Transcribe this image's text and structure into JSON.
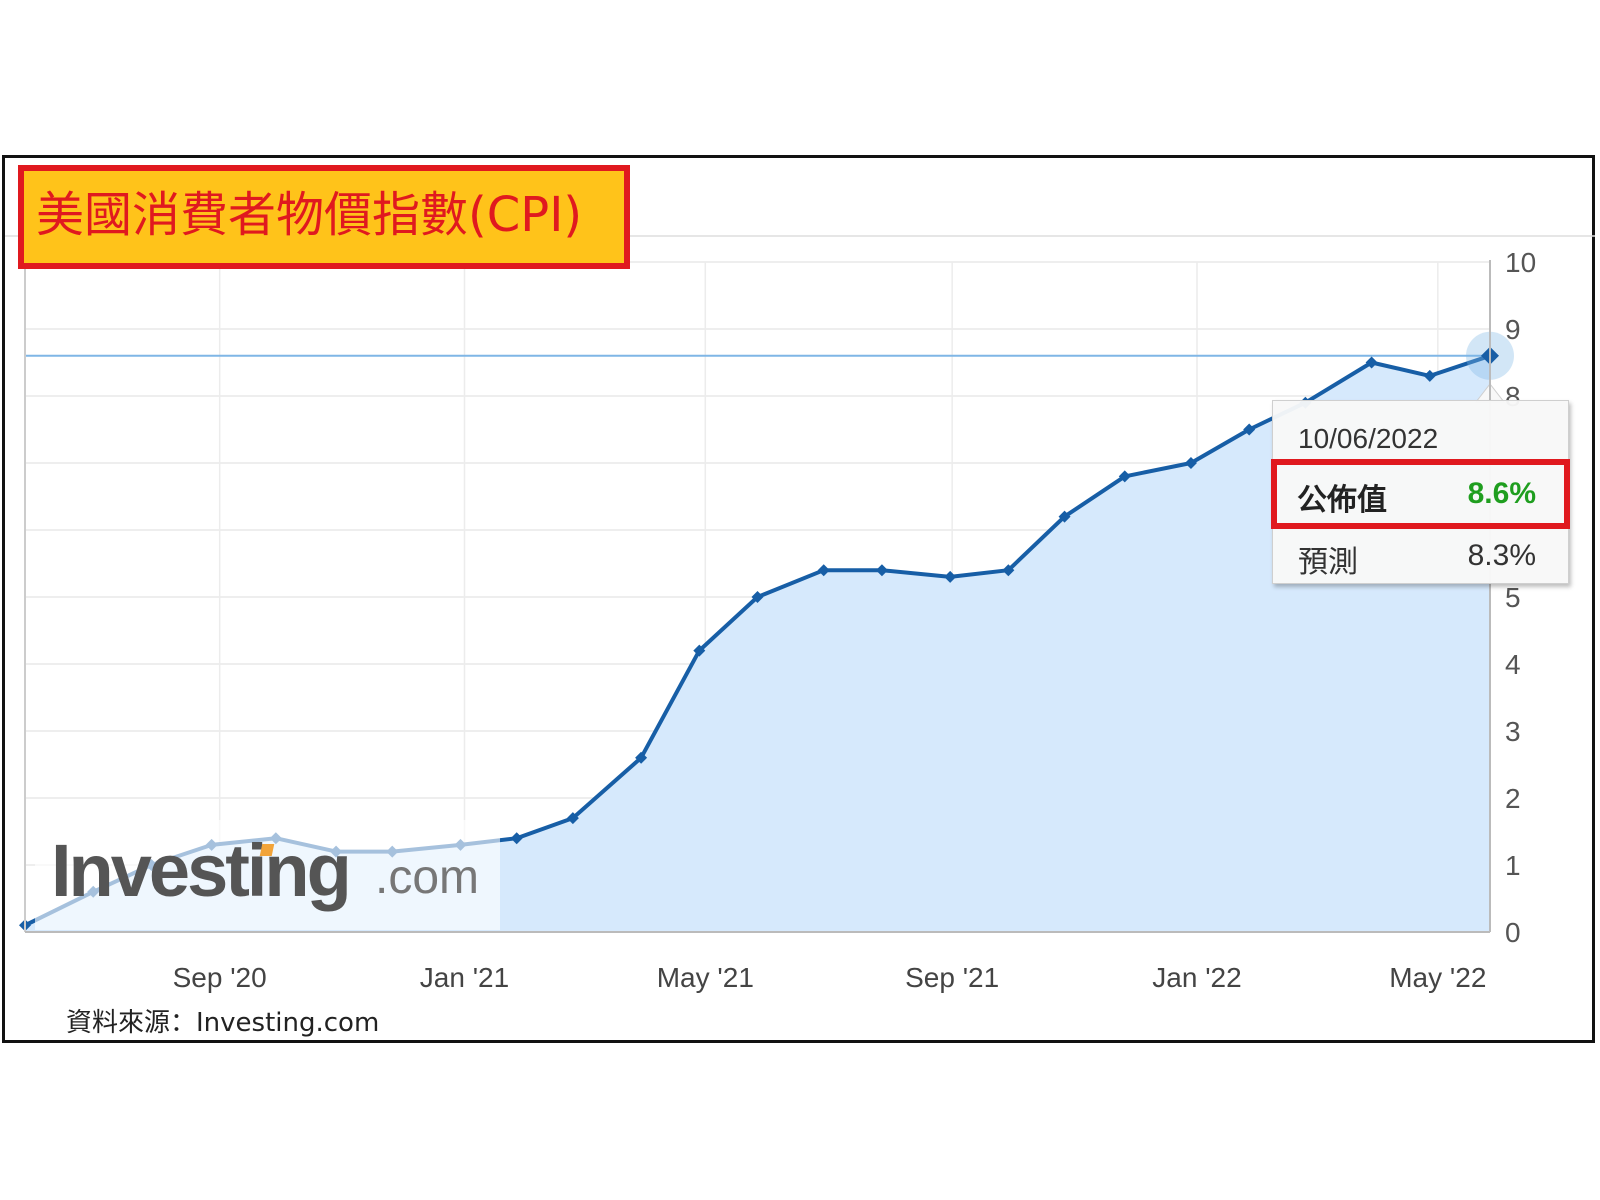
{
  "title": "美國消費者物價指數(CPI)",
  "source_note": "資料來源：Investing.com",
  "watermark": {
    "brand": "Investing",
    "suffix": ".com"
  },
  "tooltip": {
    "date": "10/06/2022",
    "actual_label": "公佈值",
    "actual_value": "8.6%",
    "forecast_label": "預測",
    "forecast_value": "8.3%"
  },
  "colors": {
    "line": "#175ea6",
    "area": "#d6e9fc",
    "highlight": "#e0191f",
    "title_bg": "#ffc31a",
    "actual_value": "#1f9e1f",
    "reference_line": "#7fb6e6"
  },
  "chart_data": {
    "type": "area",
    "title": "美國消費者物價指數(CPI)",
    "xlabel": "",
    "ylabel": "",
    "x_ticks": [
      "Sep '20",
      "Jan '21",
      "May '21",
      "Sep '21",
      "Jan '22",
      "May '22"
    ],
    "y_ticks": [
      0,
      1,
      2,
      3,
      4,
      5,
      8,
      9,
      10
    ],
    "ylim": [
      0,
      10
    ],
    "grid": true,
    "reference_line_value": 8.6,
    "series": [
      {
        "x": [
          "2020-06-10",
          "2020-07-14",
          "2020-08-12",
          "2020-09-11",
          "2020-10-13",
          "2020-11-12",
          "2020-12-10",
          "2021-01-13",
          "2021-02-10",
          "2021-03-10",
          "2021-04-13",
          "2021-05-12",
          "2021-06-10",
          "2021-07-13",
          "2021-08-11",
          "2021-09-14",
          "2021-10-13",
          "2021-11-10",
          "2021-12-10",
          "2022-01-12",
          "2022-02-10",
          "2022-03-10",
          "2022-04-12",
          "2022-05-11",
          "2022-06-10"
        ],
        "values": [
          0.1,
          0.6,
          1.0,
          1.3,
          1.4,
          1.2,
          1.2,
          1.3,
          1.4,
          1.7,
          2.6,
          4.2,
          5.0,
          5.4,
          5.4,
          5.3,
          5.4,
          6.2,
          6.8,
          7.0,
          7.5,
          7.9,
          8.5,
          8.3,
          8.6
        ]
      }
    ]
  }
}
